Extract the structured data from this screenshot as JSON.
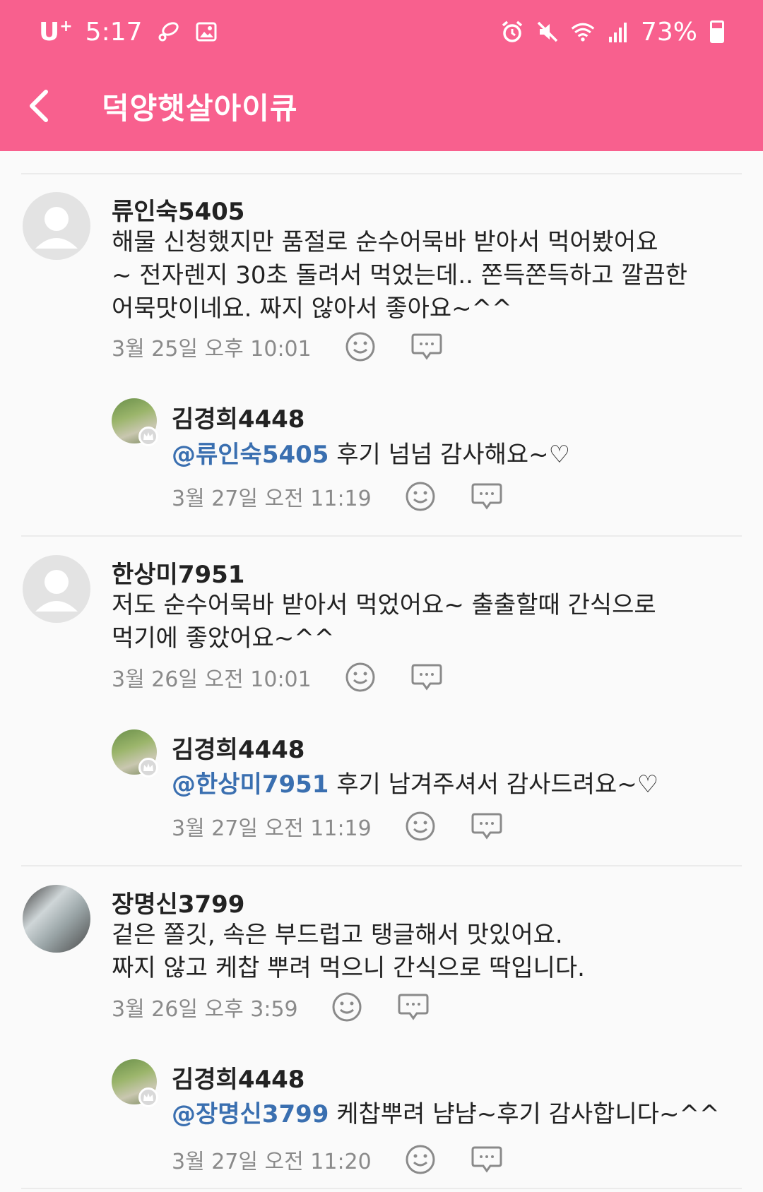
{
  "status_bar": {
    "carrier": "U",
    "carrier_sup": "+",
    "time": "5:17",
    "battery": "73%"
  },
  "header": {
    "title": "덕양햇살아이큐"
  },
  "comments": [
    {
      "author": "류인숙5405",
      "body": "해물 신청했지만 품절로 순수어묵바 받아서 먹어봤어요\n~ 전자렌지 30초 돌려서 먹었는데.. 쫀득쫀득하고 깔끔한\n어묵맛이네요. 짜지 않아서 좋아요~^^",
      "time": "3월 25일 오후 10:01",
      "reply": {
        "author": "김경희4448",
        "mention": "@류인숙5405",
        "text": " 후기 넘넘 감사해요~♡",
        "time": "3월 27일 오전 11:19"
      }
    },
    {
      "author": "한상미7951",
      "body": "저도 순수어묵바 받아서 먹었어요~ 출출할때 간식으로\n먹기에 좋았어요~^^",
      "time": "3월 26일 오전 10:01",
      "reply": {
        "author": "김경희4448",
        "mention": "@한상미7951",
        "text": " 후기 남겨주셔서 감사드려요~♡",
        "time": "3월 27일 오전 11:19"
      }
    },
    {
      "author": "장명신3799",
      "body": "겉은 쫄깃, 속은 부드럽고 탱글해서 맛있어요.\n짜지 않고 케찹 뿌려 먹으니 간식으로 딱입니다.",
      "time": "3월 26일 오후 3:59",
      "reply": {
        "author": "김경희4448",
        "mention": "@장명신3799",
        "text": " 케찹뿌려 냠냠~후기 감사합니다~^^",
        "time": "3월 27일 오전 11:20"
      }
    }
  ]
}
